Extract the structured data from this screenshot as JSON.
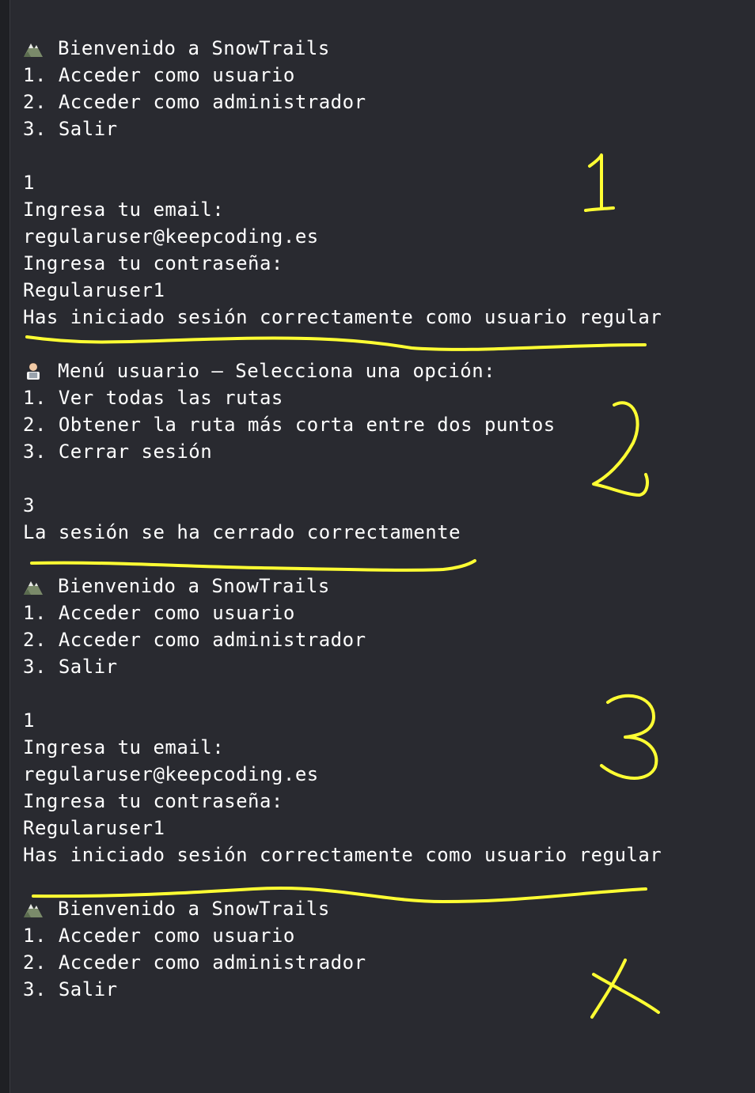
{
  "colors": {
    "background": "#292a30",
    "text": "#ffffff",
    "annotation": "#ffff33"
  },
  "console": {
    "lines": [
      {
        "icon": "mountain-icon",
        "text": "Bienvenido a SnowTrails"
      },
      {
        "text": "1. Acceder como usuario"
      },
      {
        "text": "2. Acceder como administrador"
      },
      {
        "text": "3. Salir"
      },
      {
        "text": ""
      },
      {
        "text": "1"
      },
      {
        "text": "Ingresa tu email:"
      },
      {
        "text": "regularuser@keepcoding.es"
      },
      {
        "text": "Ingresa tu contraseña:"
      },
      {
        "text": "Regularuser1"
      },
      {
        "text": "Has iniciado sesión correctamente como usuario regular"
      },
      {
        "text": ""
      },
      {
        "icon": "technologist-icon",
        "text": "Menú usuario – Selecciona una opción:"
      },
      {
        "text": "1. Ver todas las rutas"
      },
      {
        "text": "2. Obtener la ruta más corta entre dos puntos"
      },
      {
        "text": "3. Cerrar sesión"
      },
      {
        "text": ""
      },
      {
        "text": "3"
      },
      {
        "text": "La sesión se ha cerrado correctamente"
      },
      {
        "text": ""
      },
      {
        "icon": "mountain-icon",
        "text": "Bienvenido a SnowTrails"
      },
      {
        "text": "1. Acceder como usuario"
      },
      {
        "text": "2. Acceder como administrador"
      },
      {
        "text": "3. Salir"
      },
      {
        "text": ""
      },
      {
        "text": "1"
      },
      {
        "text": "Ingresa tu email:"
      },
      {
        "text": "regularuser@keepcoding.es"
      },
      {
        "text": "Ingresa tu contraseña:"
      },
      {
        "text": "Regularuser1"
      },
      {
        "text": "Has iniciado sesión correctamente como usuario regular"
      },
      {
        "text": ""
      },
      {
        "icon": "mountain-icon",
        "text": "Bienvenido a SnowTrails"
      },
      {
        "text": "1. Acceder como usuario"
      },
      {
        "text": "2. Acceder como administrador"
      },
      {
        "text": "3. Salir"
      }
    ]
  },
  "annotations": {
    "marks": [
      "1",
      "2",
      "3",
      "X"
    ]
  }
}
